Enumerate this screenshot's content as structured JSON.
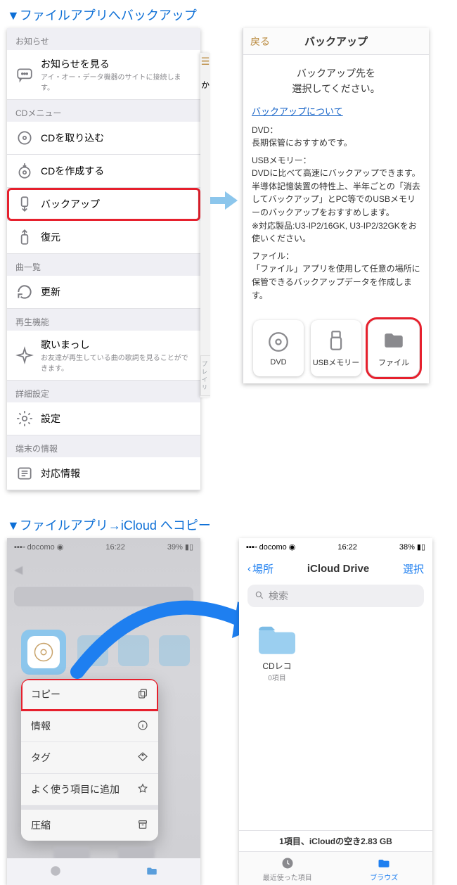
{
  "section1": {
    "title": "▼ファイルアプリへバックアップ",
    "list": {
      "groups": [
        {
          "label": "お知らせ",
          "items": [
            {
              "label": "お知らせを見る",
              "sub": "アイ・オー・データ機器のサイトに接続します。"
            }
          ]
        },
        {
          "label": "CDメニュー",
          "items": [
            {
              "label": "CDを取り込む"
            },
            {
              "label": "CDを作成する"
            },
            {
              "label": "バックアップ",
              "highlight": true
            },
            {
              "label": "復元"
            }
          ]
        },
        {
          "label": "曲一覧",
          "items": [
            {
              "label": "更新"
            }
          ]
        },
        {
          "label": "再生機能",
          "items": [
            {
              "label": "歌いまっし",
              "sub": "お友達が再生している曲の歌詞を見ることができます。"
            }
          ]
        },
        {
          "label": "詳細設定",
          "items": [
            {
              "label": "設定"
            }
          ]
        },
        {
          "label": "端末の情報",
          "items": [
            {
              "label": "対応情報"
            }
          ]
        }
      ],
      "hamburger": "☰",
      "indexChar": "か",
      "bottomTab": "プレイリ"
    },
    "detail": {
      "back": "戻る",
      "title": "バックアップ",
      "subtitle1": "バックアップ先を",
      "subtitle2": "選択してください。",
      "link": "バックアップについて",
      "dvdHead": "DVD：",
      "dvdBody": "長期保管におすすめです。",
      "usbHead": "USBメモリー：",
      "usbBody1": "DVDに比べて高速にバックアップできます。",
      "usbBody2": "半導体記憶装置の特性上、半年ごとの「消去してバックアップ」とPC等でのUSBメモリーのバックアップをおすすめします。",
      "usbBody3": "※対応製品:U3-IP2/16GK, U3-IP2/32GKをお使いください。",
      "fileHead": "ファイル：",
      "fileBody": "「ファイル」アプリを使用して任意の場所に保管できるバックアップデータを作成します。",
      "options": [
        {
          "label": "DVD"
        },
        {
          "label": "USBメモリー"
        },
        {
          "label": "ファイル",
          "highlight": true
        }
      ]
    }
  },
  "section2": {
    "title": "▼ファイルアプリ→iCloud へコピー",
    "statusL": {
      "carrier": "docomo",
      "time": "16:22",
      "battery": "39%"
    },
    "statusR": {
      "carrier": "docomo",
      "time": "16:22",
      "battery": "38%"
    },
    "menu": [
      {
        "label": "コピー",
        "highlight": true
      },
      {
        "label": "情報"
      },
      {
        "label": "タグ"
      },
      {
        "label": "よく使う項目に追加"
      },
      {
        "label": "圧縮"
      }
    ],
    "icloud": {
      "back": "場所",
      "title": "iCloud Drive",
      "select": "選択",
      "searchPlaceholder": "検索",
      "folderName": "CDレコ",
      "folderCount": "0項目",
      "footer": "1項目、iCloudの空き2.83 GB",
      "tabs": {
        "recent": "最近使った項目",
        "browse": "ブラウズ"
      }
    }
  }
}
